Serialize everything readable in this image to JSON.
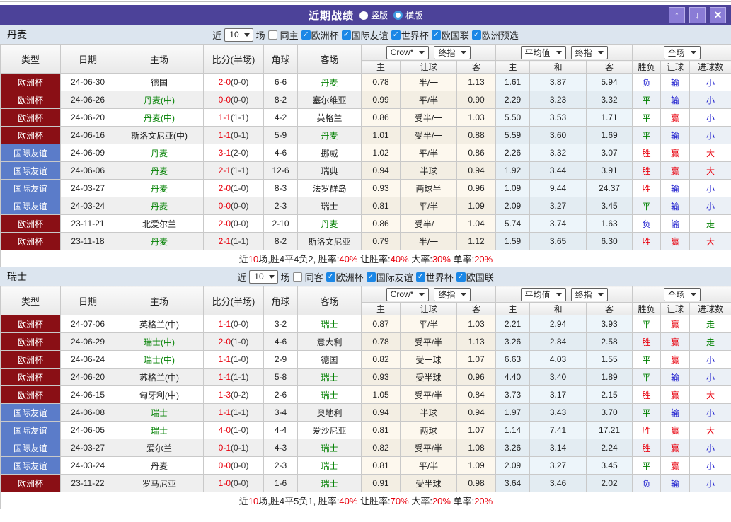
{
  "title_bar": {
    "title": "近期战绩",
    "up_icon": "↑",
    "down_icon": "↓",
    "close_icon": "✕",
    "layout_options": [
      {
        "label": "竖版",
        "selected": false
      },
      {
        "label": "横版",
        "selected": true
      }
    ]
  },
  "check_glyph": "✓",
  "filter_labels": {
    "near": "近",
    "count": "10",
    "matches": "场"
  },
  "table_header": {
    "type": "类型",
    "date": "日期",
    "home": "主场",
    "score": "比分(半场)",
    "corner": "角球",
    "away": "客场",
    "bookmaker_select": "Crow*",
    "final_select": "终指",
    "average_select": "平均值",
    "average_final_select": "终指",
    "scope_select": "全场",
    "sub_home": "主",
    "sub_handicap": "让球",
    "sub_away": "客",
    "sub_avg_home": "主",
    "sub_avg_draw": "和",
    "sub_avg_away": "客",
    "sub_result": "胜负",
    "sub_result_handicap": "让球",
    "sub_goals": "进球数"
  },
  "colors": {
    "titlebar": "#4c4299",
    "cup": "#8a0f15",
    "friendly": "#5b7cc9",
    "win": "#e8000d",
    "draw": "#008000",
    "lose": "#2121cf"
  },
  "sections": [
    {
      "team": "丹麦",
      "same_side_label": "同主",
      "same_side_checked": false,
      "leagues": [
        {
          "label": "欧洲杯",
          "checked": true
        },
        {
          "label": "国际友谊",
          "checked": true
        },
        {
          "label": "世界杯",
          "checked": true
        },
        {
          "label": "欧国联",
          "checked": true
        },
        {
          "label": "欧洲预选",
          "checked": true
        }
      ],
      "rows": [
        {
          "league": "欧洲杯",
          "league_type": "cup",
          "date": "24-06-30",
          "home": "德国",
          "home_is_team": false,
          "score": "2-0",
          "half": "(0-0)",
          "corners": "6-6",
          "away": "丹麦",
          "away_is_team": true,
          "odds_home": "0.78",
          "odds_handicap": "半/一",
          "odds_away": "1.13",
          "avg_home": "1.61",
          "avg_draw": "3.87",
          "avg_away": "5.94",
          "result": {
            "t": "负",
            "c": "blue"
          },
          "handicap_result": {
            "t": "输",
            "c": "blue"
          },
          "goals_result": {
            "t": "小",
            "c": "blue"
          }
        },
        {
          "league": "欧洲杯",
          "league_type": "cup",
          "date": "24-06-26",
          "home": "丹麦(中)",
          "home_is_team": true,
          "score": "0-0",
          "half": "(0-0)",
          "corners": "8-2",
          "away": "塞尔维亚",
          "away_is_team": false,
          "odds_home": "0.99",
          "odds_handicap": "平/半",
          "odds_away": "0.90",
          "avg_home": "2.29",
          "avg_draw": "3.23",
          "avg_away": "3.32",
          "result": {
            "t": "平",
            "c": "green"
          },
          "handicap_result": {
            "t": "输",
            "c": "blue"
          },
          "goals_result": {
            "t": "小",
            "c": "blue"
          }
        },
        {
          "league": "欧洲杯",
          "league_type": "cup",
          "date": "24-06-20",
          "home": "丹麦(中)",
          "home_is_team": true,
          "score": "1-1",
          "half": "(1-1)",
          "corners": "4-2",
          "away": "英格兰",
          "away_is_team": false,
          "odds_home": "0.86",
          "odds_handicap": "受半/一",
          "odds_away": "1.03",
          "avg_home": "5.50",
          "avg_draw": "3.53",
          "avg_away": "1.71",
          "result": {
            "t": "平",
            "c": "green"
          },
          "handicap_result": {
            "t": "赢",
            "c": "red"
          },
          "goals_result": {
            "t": "小",
            "c": "blue"
          }
        },
        {
          "league": "欧洲杯",
          "league_type": "cup",
          "date": "24-06-16",
          "home": "斯洛文尼亚(中)",
          "home_is_team": false,
          "score": "1-1",
          "half": "(0-1)",
          "corners": "5-9",
          "away": "丹麦",
          "away_is_team": true,
          "odds_home": "1.01",
          "odds_handicap": "受半/一",
          "odds_away": "0.88",
          "avg_home": "5.59",
          "avg_draw": "3.60",
          "avg_away": "1.69",
          "result": {
            "t": "平",
            "c": "green"
          },
          "handicap_result": {
            "t": "输",
            "c": "blue"
          },
          "goals_result": {
            "t": "小",
            "c": "blue"
          }
        },
        {
          "league": "国际友谊",
          "league_type": "friendly",
          "date": "24-06-09",
          "home": "丹麦",
          "home_is_team": true,
          "score": "3-1",
          "half": "(2-0)",
          "corners": "4-6",
          "away": "挪威",
          "away_is_team": false,
          "odds_home": "1.02",
          "odds_handicap": "平/半",
          "odds_away": "0.86",
          "avg_home": "2.26",
          "avg_draw": "3.32",
          "avg_away": "3.07",
          "result": {
            "t": "胜",
            "c": "red"
          },
          "handicap_result": {
            "t": "赢",
            "c": "red"
          },
          "goals_result": {
            "t": "大",
            "c": "red"
          }
        },
        {
          "league": "国际友谊",
          "league_type": "friendly",
          "date": "24-06-06",
          "home": "丹麦",
          "home_is_team": true,
          "score": "2-1",
          "half": "(1-1)",
          "corners": "12-6",
          "away": "瑞典",
          "away_is_team": false,
          "odds_home": "0.94",
          "odds_handicap": "半球",
          "odds_away": "0.94",
          "avg_home": "1.92",
          "avg_draw": "3.44",
          "avg_away": "3.91",
          "result": {
            "t": "胜",
            "c": "red"
          },
          "handicap_result": {
            "t": "赢",
            "c": "red"
          },
          "goals_result": {
            "t": "大",
            "c": "red"
          }
        },
        {
          "league": "国际友谊",
          "league_type": "friendly",
          "date": "24-03-27",
          "home": "丹麦",
          "home_is_team": true,
          "score": "2-0",
          "half": "(1-0)",
          "corners": "8-3",
          "away": "法罗群岛",
          "away_is_team": false,
          "odds_home": "0.93",
          "odds_handicap": "两球半",
          "odds_away": "0.96",
          "avg_home": "1.09",
          "avg_draw": "9.44",
          "avg_away": "24.37",
          "result": {
            "t": "胜",
            "c": "red"
          },
          "handicap_result": {
            "t": "输",
            "c": "blue"
          },
          "goals_result": {
            "t": "小",
            "c": "blue"
          }
        },
        {
          "league": "国际友谊",
          "league_type": "friendly",
          "date": "24-03-24",
          "home": "丹麦",
          "home_is_team": true,
          "score": "0-0",
          "half": "(0-0)",
          "corners": "2-3",
          "away": "瑞士",
          "away_is_team": false,
          "odds_home": "0.81",
          "odds_handicap": "平/半",
          "odds_away": "1.09",
          "avg_home": "2.09",
          "avg_draw": "3.27",
          "avg_away": "3.45",
          "result": {
            "t": "平",
            "c": "green"
          },
          "handicap_result": {
            "t": "输",
            "c": "blue"
          },
          "goals_result": {
            "t": "小",
            "c": "blue"
          }
        },
        {
          "league": "欧洲杯",
          "league_type": "cup",
          "date": "23-11-21",
          "home": "北爱尔兰",
          "home_is_team": false,
          "score": "2-0",
          "half": "(0-0)",
          "corners": "2-10",
          "away": "丹麦",
          "away_is_team": true,
          "odds_home": "0.86",
          "odds_handicap": "受半/一",
          "odds_away": "1.04",
          "avg_home": "5.74",
          "avg_draw": "3.74",
          "avg_away": "1.63",
          "result": {
            "t": "负",
            "c": "blue"
          },
          "handicap_result": {
            "t": "输",
            "c": "blue"
          },
          "goals_result": {
            "t": "走",
            "c": "green"
          }
        },
        {
          "league": "欧洲杯",
          "league_type": "cup",
          "date": "23-11-18",
          "home": "丹麦",
          "home_is_team": true,
          "score": "2-1",
          "half": "(1-1)",
          "corners": "8-2",
          "away": "斯洛文尼亚",
          "away_is_team": false,
          "odds_home": "0.79",
          "odds_handicap": "半/一",
          "odds_away": "1.12",
          "avg_home": "1.59",
          "avg_draw": "3.65",
          "avg_away": "6.30",
          "result": {
            "t": "胜",
            "c": "red"
          },
          "handicap_result": {
            "t": "赢",
            "c": "red"
          },
          "goals_result": {
            "t": "大",
            "c": "red"
          }
        }
      ],
      "summary": [
        {
          "t": "近"
        },
        {
          "t": "10",
          "red": true
        },
        {
          "t": "场,胜4平4负2, 胜率:"
        },
        {
          "t": "40%",
          "red": true
        },
        {
          "t": " 让胜率:"
        },
        {
          "t": "40%",
          "red": true
        },
        {
          "t": " 大率:"
        },
        {
          "t": "30%",
          "red": true
        },
        {
          "t": " 单率:"
        },
        {
          "t": "20%",
          "red": true
        }
      ]
    },
    {
      "team": "瑞士",
      "same_side_label": "同客",
      "same_side_checked": false,
      "leagues": [
        {
          "label": "欧洲杯",
          "checked": true
        },
        {
          "label": "国际友谊",
          "checked": true
        },
        {
          "label": "世界杯",
          "checked": true
        },
        {
          "label": "欧国联",
          "checked": true
        }
      ],
      "rows": [
        {
          "league": "欧洲杯",
          "league_type": "cup",
          "date": "24-07-06",
          "home": "英格兰(中)",
          "home_is_team": false,
          "score": "1-1",
          "half": "(0-0)",
          "corners": "3-2",
          "away": "瑞士",
          "away_is_team": true,
          "odds_home": "0.87",
          "odds_handicap": "平/半",
          "odds_away": "1.03",
          "avg_home": "2.21",
          "avg_draw": "2.94",
          "avg_away": "3.93",
          "result": {
            "t": "平",
            "c": "green"
          },
          "handicap_result": {
            "t": "赢",
            "c": "red"
          },
          "goals_result": {
            "t": "走",
            "c": "green"
          }
        },
        {
          "league": "欧洲杯",
          "league_type": "cup",
          "date": "24-06-29",
          "home": "瑞士(中)",
          "home_is_team": true,
          "score": "2-0",
          "half": "(1-0)",
          "corners": "4-6",
          "away": "意大利",
          "away_is_team": false,
          "odds_home": "0.78",
          "odds_handicap": "受平/半",
          "odds_away": "1.13",
          "avg_home": "3.26",
          "avg_draw": "2.84",
          "avg_away": "2.58",
          "result": {
            "t": "胜",
            "c": "red"
          },
          "handicap_result": {
            "t": "赢",
            "c": "red"
          },
          "goals_result": {
            "t": "走",
            "c": "green"
          }
        },
        {
          "league": "欧洲杯",
          "league_type": "cup",
          "date": "24-06-24",
          "home": "瑞士(中)",
          "home_is_team": true,
          "score": "1-1",
          "half": "(1-0)",
          "corners": "2-9",
          "away": "德国",
          "away_is_team": false,
          "odds_home": "0.82",
          "odds_handicap": "受一球",
          "odds_away": "1.07",
          "avg_home": "6.63",
          "avg_draw": "4.03",
          "avg_away": "1.55",
          "result": {
            "t": "平",
            "c": "green"
          },
          "handicap_result": {
            "t": "赢",
            "c": "red"
          },
          "goals_result": {
            "t": "小",
            "c": "blue"
          }
        },
        {
          "league": "欧洲杯",
          "league_type": "cup",
          "date": "24-06-20",
          "home": "苏格兰(中)",
          "home_is_team": false,
          "score": "1-1",
          "half": "(1-1)",
          "corners": "5-8",
          "away": "瑞士",
          "away_is_team": true,
          "odds_home": "0.93",
          "odds_handicap": "受半球",
          "odds_away": "0.96",
          "avg_home": "4.40",
          "avg_draw": "3.40",
          "avg_away": "1.89",
          "result": {
            "t": "平",
            "c": "green"
          },
          "handicap_result": {
            "t": "输",
            "c": "blue"
          },
          "goals_result": {
            "t": "小",
            "c": "blue"
          }
        },
        {
          "league": "欧洲杯",
          "league_type": "cup",
          "date": "24-06-15",
          "home": "匈牙利(中)",
          "home_is_team": false,
          "score": "1-3",
          "half": "(0-2)",
          "corners": "2-6",
          "away": "瑞士",
          "away_is_team": true,
          "odds_home": "1.05",
          "odds_handicap": "受平/半",
          "odds_away": "0.84",
          "avg_home": "3.73",
          "avg_draw": "3.17",
          "avg_away": "2.15",
          "result": {
            "t": "胜",
            "c": "red"
          },
          "handicap_result": {
            "t": "赢",
            "c": "red"
          },
          "goals_result": {
            "t": "大",
            "c": "red"
          }
        },
        {
          "league": "国际友谊",
          "league_type": "friendly",
          "date": "24-06-08",
          "home": "瑞士",
          "home_is_team": true,
          "score": "1-1",
          "half": "(1-1)",
          "corners": "3-4",
          "away": "奥地利",
          "away_is_team": false,
          "odds_home": "0.94",
          "odds_handicap": "半球",
          "odds_away": "0.94",
          "avg_home": "1.97",
          "avg_draw": "3.43",
          "avg_away": "3.70",
          "result": {
            "t": "平",
            "c": "green"
          },
          "handicap_result": {
            "t": "输",
            "c": "blue"
          },
          "goals_result": {
            "t": "小",
            "c": "blue"
          }
        },
        {
          "league": "国际友谊",
          "league_type": "friendly",
          "date": "24-06-05",
          "home": "瑞士",
          "home_is_team": true,
          "score": "4-0",
          "half": "(1-0)",
          "corners": "4-4",
          "away": "爱沙尼亚",
          "away_is_team": false,
          "odds_home": "0.81",
          "odds_handicap": "两球",
          "odds_away": "1.07",
          "avg_home": "1.14",
          "avg_draw": "7.41",
          "avg_away": "17.21",
          "result": {
            "t": "胜",
            "c": "red"
          },
          "handicap_result": {
            "t": "赢",
            "c": "red"
          },
          "goals_result": {
            "t": "大",
            "c": "red"
          }
        },
        {
          "league": "国际友谊",
          "league_type": "friendly",
          "date": "24-03-27",
          "home": "爱尔兰",
          "home_is_team": false,
          "score": "0-1",
          "half": "(0-1)",
          "corners": "4-3",
          "away": "瑞士",
          "away_is_team": true,
          "odds_home": "0.82",
          "odds_handicap": "受平/半",
          "odds_away": "1.08",
          "avg_home": "3.26",
          "avg_draw": "3.14",
          "avg_away": "2.24",
          "result": {
            "t": "胜",
            "c": "red"
          },
          "handicap_result": {
            "t": "赢",
            "c": "red"
          },
          "goals_result": {
            "t": "小",
            "c": "blue"
          }
        },
        {
          "league": "国际友谊",
          "league_type": "friendly",
          "date": "24-03-24",
          "home": "丹麦",
          "home_is_team": false,
          "score": "0-0",
          "half": "(0-0)",
          "corners": "2-3",
          "away": "瑞士",
          "away_is_team": true,
          "odds_home": "0.81",
          "odds_handicap": "平/半",
          "odds_away": "1.09",
          "avg_home": "2.09",
          "avg_draw": "3.27",
          "avg_away": "3.45",
          "result": {
            "t": "平",
            "c": "green"
          },
          "handicap_result": {
            "t": "赢",
            "c": "red"
          },
          "goals_result": {
            "t": "小",
            "c": "blue"
          }
        },
        {
          "league": "欧洲杯",
          "league_type": "cup",
          "date": "23-11-22",
          "home": "罗马尼亚",
          "home_is_team": false,
          "score": "1-0",
          "half": "(0-0)",
          "corners": "1-6",
          "away": "瑞士",
          "away_is_team": true,
          "odds_home": "0.91",
          "odds_handicap": "受半球",
          "odds_away": "0.98",
          "avg_home": "3.64",
          "avg_draw": "3.46",
          "avg_away": "2.02",
          "result": {
            "t": "负",
            "c": "blue"
          },
          "handicap_result": {
            "t": "输",
            "c": "blue"
          },
          "goals_result": {
            "t": "小",
            "c": "blue"
          }
        }
      ],
      "summary": [
        {
          "t": "近"
        },
        {
          "t": "10",
          "red": true
        },
        {
          "t": "场,胜4平5负1, 胜率:"
        },
        {
          "t": "40%",
          "red": true
        },
        {
          "t": " 让胜率:"
        },
        {
          "t": "70%",
          "red": true
        },
        {
          "t": " 大率:"
        },
        {
          "t": "20%",
          "red": true
        },
        {
          "t": " 单率:"
        },
        {
          "t": "20%",
          "red": true
        }
      ]
    }
  ]
}
